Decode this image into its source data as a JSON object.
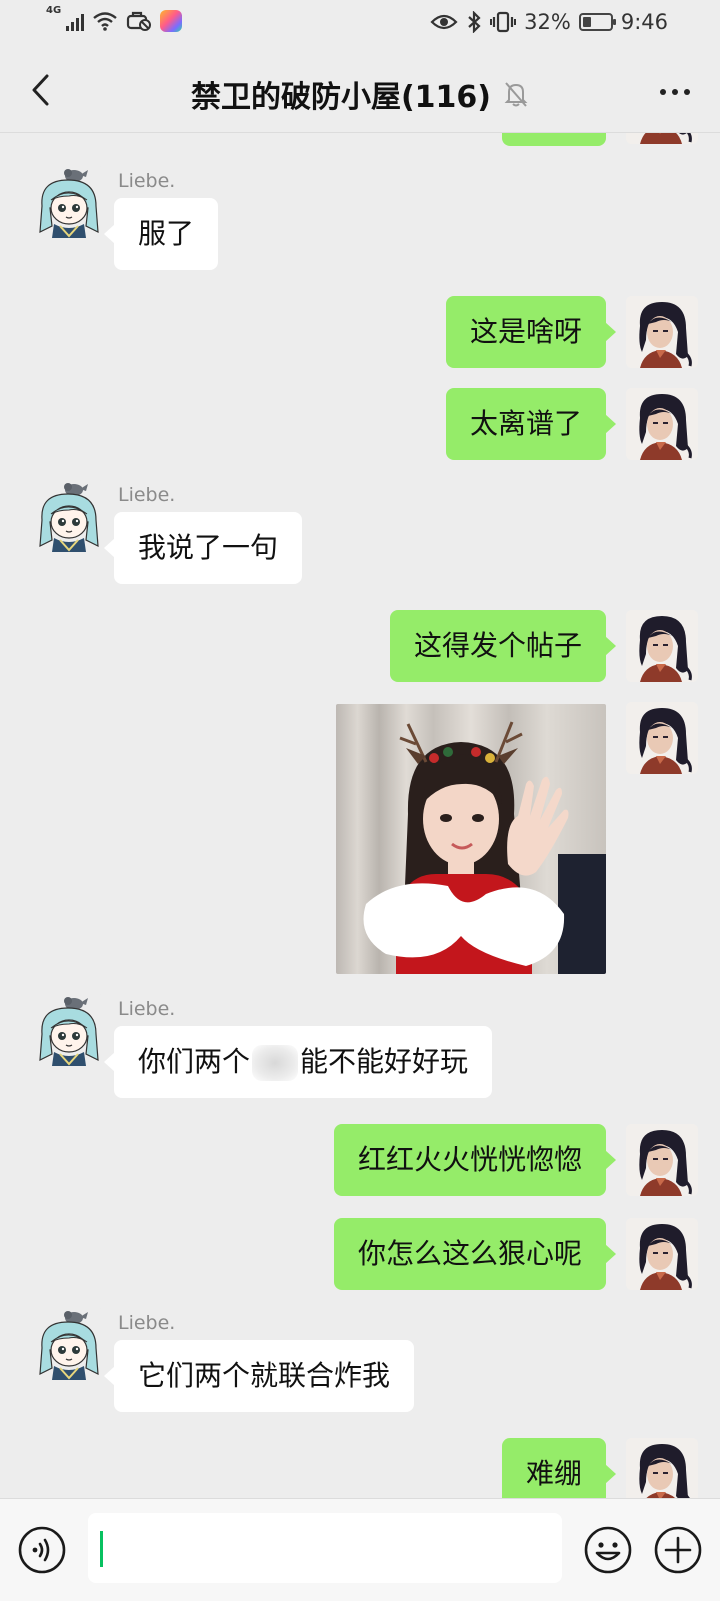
{
  "status_bar": {
    "network": "4G",
    "battery_percent": "32%",
    "battery_level": 0.32,
    "time": "9:46",
    "icons": [
      "signal-icon",
      "wifi-icon",
      "vpn-icon",
      "app-icon",
      "eye-icon",
      "bluetooth-icon",
      "vibrate-icon",
      "battery-icon"
    ]
  },
  "nav": {
    "title": "禁卫的破防小屋(116)",
    "icons": [
      "back-icon",
      "mute-bell-icon",
      "more-icon"
    ]
  },
  "messages": [
    {
      "side": "out",
      "kind": "text",
      "text": ""
    },
    {
      "side": "in",
      "sender": "Liebe.",
      "kind": "text",
      "text": "服了"
    },
    {
      "side": "out",
      "kind": "text",
      "text": "这是啥呀"
    },
    {
      "side": "out",
      "kind": "text",
      "text": "太离谱了"
    },
    {
      "side": "in",
      "sender": "Liebe.",
      "kind": "text",
      "text": "我说了一句"
    },
    {
      "side": "out",
      "kind": "text",
      "text": "这得发个帖子"
    },
    {
      "side": "out",
      "kind": "image"
    },
    {
      "side": "in",
      "sender": "Liebe.",
      "kind": "text",
      "text_before": "你们两个",
      "text_after": "能不能好好玩"
    },
    {
      "side": "out",
      "kind": "text",
      "text": "红红火火恍恍惚惚"
    },
    {
      "side": "out",
      "kind": "text",
      "text": "你怎么这么狠心呢"
    },
    {
      "side": "in",
      "sender": "Liebe.",
      "kind": "text",
      "text": "它们两个就联合炸我"
    },
    {
      "side": "out",
      "kind": "text",
      "text": "难绷"
    }
  ],
  "input_bar": {
    "value": "",
    "icons": [
      "voice-icon",
      "emoji-icon",
      "plus-icon"
    ]
  },
  "colors": {
    "background": "#ededed",
    "outgoing_bubble": "#95ec69",
    "incoming_bubble": "#ffffff",
    "caret": "#07c160"
  }
}
